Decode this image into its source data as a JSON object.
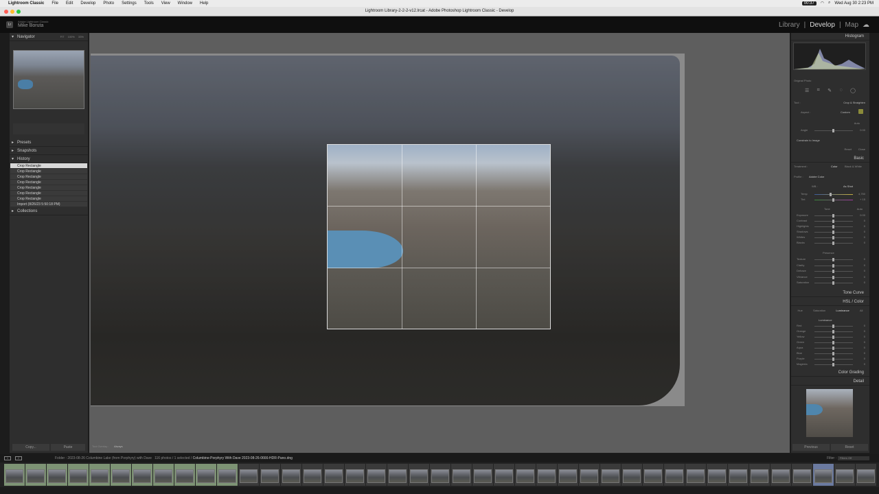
{
  "menubar": {
    "app": "Lightroom Classic",
    "items": [
      "File",
      "Edit",
      "Develop",
      "Photo",
      "Settings",
      "Tools",
      "View",
      "Window",
      "Help"
    ],
    "status_time": "00:37",
    "datetime": "Wed Aug 30  2:23 PM"
  },
  "window": {
    "title": "Lightroom Library-2-2-2-v12.lrcat - Adobe Photoshop Lightroom Classic - Develop"
  },
  "identity": {
    "line1": "Adobe Lightroom Classic",
    "line2": "Mike Boruta"
  },
  "modules": {
    "library": "Library",
    "develop": "Develop",
    "map": "Map",
    "sep": "|"
  },
  "left": {
    "navigator": "Navigator",
    "nav_opts": [
      "FIT",
      "100%",
      "33%"
    ],
    "presets": "Presets",
    "snapshots": "Snapshots",
    "history": "History",
    "collections": "Collections",
    "history_items": [
      "Crop Rectangle",
      "Crop Rectangle",
      "Crop Rectangle",
      "Crop Rectangle",
      "Crop Rectangle",
      "Crop Rectangle",
      "Crop Rectangle",
      "Import (8/26/23 5:50:18 PM)"
    ],
    "copy": "Copy...",
    "paste": "Paste"
  },
  "toolbar": {
    "tool_overlay": "Tool Overlay :",
    "tool_overlay_val": "Always"
  },
  "right": {
    "histogram": "Histogram",
    "original_photo": "Original Photo",
    "tool": "Tool :",
    "crop_straighten": "Crop & Straighten",
    "aspect": "Aspect :",
    "aspect_val": "Custom",
    "auto": "Auto",
    "angle": "Angle",
    "angle_val": "0.00",
    "constrain": "Constrain to Image",
    "reset": "Reset",
    "close": "Close",
    "basic": "Basic",
    "treatment": "Treatment :",
    "color": "Color",
    "bw": "Black & White",
    "profile": "Profile :",
    "profile_val": "Adobe Color",
    "wb": "WB :",
    "wb_val": "As Shot",
    "temp": "Temp",
    "temp_val": "4,750",
    "tint": "Tint",
    "tint_val": "+ 15",
    "tone": "Tone",
    "tone_auto": "Auto",
    "tone_rows": [
      {
        "n": "Exposure",
        "v": "0.00"
      },
      {
        "n": "Contrast",
        "v": "0"
      },
      {
        "n": "Highlights",
        "v": "0"
      },
      {
        "n": "Shadows",
        "v": "0"
      },
      {
        "n": "Whites",
        "v": "0"
      },
      {
        "n": "Blacks",
        "v": "0"
      }
    ],
    "presence": "Presence",
    "presence_rows": [
      {
        "n": "Texture",
        "v": "0"
      },
      {
        "n": "Clarity",
        "v": "0"
      },
      {
        "n": "Dehaze",
        "v": "0"
      },
      {
        "n": "Vibrance",
        "v": "0"
      },
      {
        "n": "Saturation",
        "v": "0"
      }
    ],
    "tone_curve": "Tone Curve",
    "hsl": "HSL / Color",
    "hsl_tabs": [
      "Hue",
      "Saturation",
      "Luminance",
      "All"
    ],
    "luminance": "Luminance",
    "hsl_rows": [
      {
        "n": "Red",
        "v": "0"
      },
      {
        "n": "Orange",
        "v": "0"
      },
      {
        "n": "Yellow",
        "v": "0"
      },
      {
        "n": "Green",
        "v": "0"
      },
      {
        "n": "Aqua",
        "v": "0"
      },
      {
        "n": "Blue",
        "v": "0"
      },
      {
        "n": "Purple",
        "v": "0"
      },
      {
        "n": "Magenta",
        "v": "0"
      }
    ],
    "color_grading": "Color Grading",
    "detail": "Detail",
    "previous": "Previous",
    "reset_btn": "Reset"
  },
  "filmstrip": {
    "folder": "Folder : 2023-08-26 Columbine Lake (from Porphyry) with Dave",
    "count": "116 photos / 1 selected /",
    "file": "Columbine-Porphyry With Dave 2023-08-26-0666-HDR-Pano.dng",
    "filter": "Filter :",
    "filter_val": "Filters Off",
    "page1": "1",
    "page2": "2"
  },
  "colors": {
    "accent": "#dddddd",
    "panel": "#2e2e2e",
    "viewer": "#5e5e5e"
  }
}
